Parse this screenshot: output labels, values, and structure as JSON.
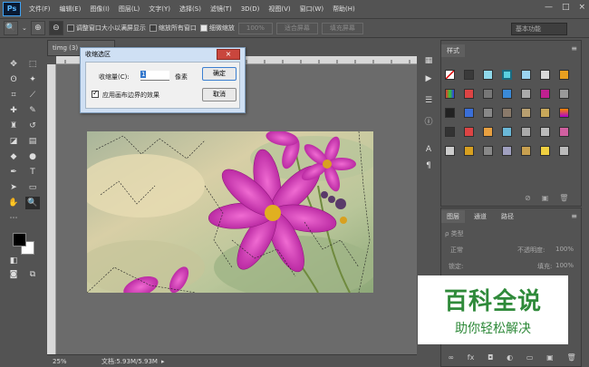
{
  "app": {
    "logo": "Ps",
    "window_controls": [
      "—",
      "□",
      "×"
    ]
  },
  "menu": [
    "文件(F)",
    "编辑(E)",
    "图像(I)",
    "图层(L)",
    "文字(Y)",
    "选择(S)",
    "滤镜(T)",
    "3D(D)",
    "视图(V)",
    "窗口(W)",
    "帮助(H)"
  ],
  "options": {
    "fit_window_label": "调整窗口大小以满屏显示",
    "zoom_all_label": "缩放所有窗口",
    "scrubby_zoom_label": "细微缩放",
    "zoom_value": "100%",
    "fit_screen_label": "适合屏幕",
    "fill_screen_label": "填充屏幕",
    "workspace": "基本功能"
  },
  "document": {
    "tab_title": "timg (3)",
    "zoom_status": "25%",
    "doc_size": "文档:5.93M/5.93M"
  },
  "dialog": {
    "title": "收缩选区",
    "close": "×",
    "contract_label": "收缩量(C):",
    "contract_value": "1",
    "unit": "像素",
    "apply_edge_label": "应用画布边界的效果",
    "ok": "确定",
    "cancel": "取消"
  },
  "styles_panel": {
    "tab": "样式"
  },
  "layers_panel": {
    "tabs": [
      "图层",
      "通道",
      "路径"
    ],
    "kind_label": "ρ 类型",
    "blend_mode": "正常",
    "opacity_label": "不透明度:",
    "opacity": "100%",
    "lock_label": "锁定:",
    "fill_label": "填充:",
    "fill": "100%"
  },
  "watermark": {
    "big": "百科全说",
    "small": "助你轻松解决"
  },
  "colors": {
    "ui_bg": "#535353",
    "canvas_bg": "#6b6b6b",
    "dialog_bg": "#cfe0f4",
    "watermark_green": "#2f8a3a"
  },
  "icons": {
    "zoom_tool": "magnifier-icon",
    "move_tool": "move-icon",
    "hand_tool": "hand-icon"
  }
}
